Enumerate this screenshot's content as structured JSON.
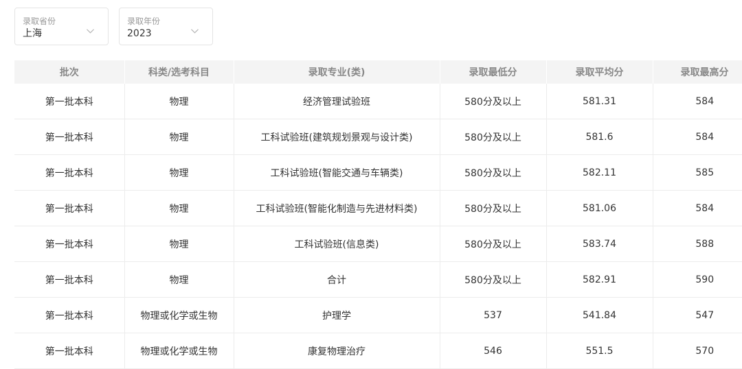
{
  "filters": {
    "province": {
      "label": "录取省份",
      "value": "上海"
    },
    "year": {
      "label": "录取年份",
      "value": "2023"
    }
  },
  "table": {
    "headers": [
      "批次",
      "科类/选考科目",
      "录取专业(类)",
      "录取最低分",
      "录取平均分",
      "录取最高分"
    ],
    "rows": [
      [
        "第一批本科",
        "物理",
        "经济管理试验班",
        "580分及以上",
        "581.31",
        "584"
      ],
      [
        "第一批本科",
        "物理",
        "工科试验班(建筑规划景观与设计类)",
        "580分及以上",
        "581.6",
        "584"
      ],
      [
        "第一批本科",
        "物理",
        "工科试验班(智能交通与车辆类)",
        "580分及以上",
        "582.11",
        "585"
      ],
      [
        "第一批本科",
        "物理",
        "工科试验班(智能化制造与先进材料类)",
        "580分及以上",
        "581.06",
        "584"
      ],
      [
        "第一批本科",
        "物理",
        "工科试验班(信息类)",
        "580分及以上",
        "583.74",
        "588"
      ],
      [
        "第一批本科",
        "物理",
        "合计",
        "580分及以上",
        "582.91",
        "590"
      ],
      [
        "第一批本科",
        "物理或化学或生物",
        "护理学",
        "537",
        "541.84",
        "547"
      ],
      [
        "第一批本科",
        "物理或化学或生物",
        "康复物理治疗",
        "546",
        "551.5",
        "570"
      ]
    ]
  }
}
